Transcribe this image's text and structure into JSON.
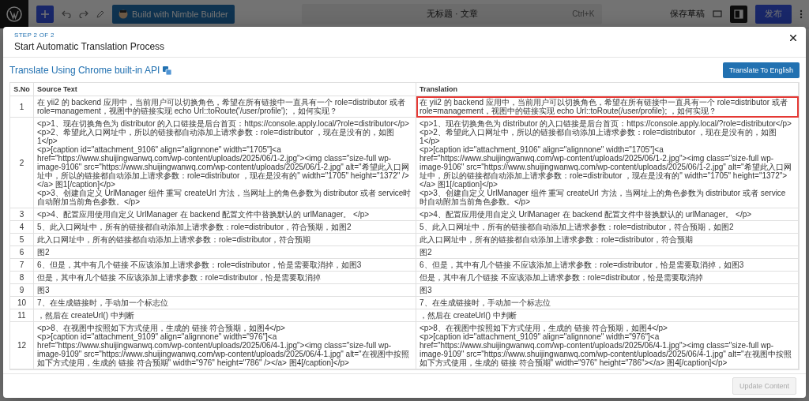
{
  "editor_bar": {
    "builder_button": "Build with Nimble Builder",
    "command_title": "无标题 · 文章",
    "command_shortcut": "Ctrl+K",
    "save_draft": "保存草稿",
    "publish": "发布"
  },
  "modal": {
    "step": "STEP 2 OF 2",
    "title": "Start Automatic Translation Process",
    "heading": "Translate Using Chrome built-in API",
    "translate_button": "Translate To English",
    "update_button": {
      "label": "Update Content",
      "disabled": true
    },
    "table": {
      "columns": [
        "S.No",
        "Source Text",
        "Translation"
      ],
      "rows": [
        {
          "no": "1",
          "source": "在 yii2 的 backend 应用中，当前用户可以切换角色，希望在所有链接中一直具有一个 role=distributor 或者 role=management，视图中的链接实现 echo Url::toRoute('/user/profile'); ，如何实现？",
          "translation": "在 yii2 的 backend 应用中，当前用户可以切换角色，希望在所有链接中一直具有一个 role=distributor 或者 role=management，视图中的链接实现 echo Url::toRoute(/user/profile); ，如何实现？",
          "highlighted": true
        },
        {
          "no": "2",
          "source": "<p>1、现在切换角色为 distributor 的入口链接是后台首页：https://console.apply.local/?role=distributor</p>\n<p>2、希望此入口网址中，所以的链接都自动添加上请求参数：role=distributor ，现在是没有的，如图1</p>\n<p>[caption id=\"attachment_9106\" align=\"alignnone\" width=\"1705\"]<a href=\"https://www.shuijingwanwq.com/wp-content/uploads/2025/06/1-2.jpg\"><img class=\"size-full wp-image-9106\" src=\"https://www.shuijingwanwq.com/wp-content/uploads/2025/06/1-2.jpg\" alt=\"希望此入口网址中，所以的链接都自动添加上请求参数：role=distributor ，现在是没有的\" width=\"1705\" height=\"1372\" /></a> 图1[/caption]</p>\n<p>3、创建自定义 UrlManager 组件 重写 createUrl 方法，当网址上的角色参数为 distributor 或者 service时自动附加当前角色参数。</p>",
          "translation": "<p>1、现在切换角色为 distributor 的入口链接是后台首页：https://console.apply.local/?role=distributor</p>\n<p>2、希望此入口网址中，所以的链接都自动添加上请求参数：role=distributor ，现在是没有的，如图1</p>\n<p>[caption id=\"attachment_9106\" align=\"alignnone\" width=\"1705\"]<a href=\"https://www.shuijingwanwq.com/wp-content/uploads/2025/06/1-2.jpg\"><img class=\"size-full wp-image-9106\" src=\"https://www.shuijingwanwq.com/wp-content/uploads/2025/06/1-2.jpg\" alt=\"希望此入口网址中，所以的链接都自动添加上请求参数：role=distributor ，现在是没有的\" width=\"1705\" height=\"1372\"></a> 图1[/caption]</p>\n<p>3、创建自定义 UrlManager 组件 重写 createUrl 方法，当网址上的角色参数为 distributor 或者 service 时自动附加当前角色参数。</p>",
          "highlighted": false
        },
        {
          "no": "3",
          "source": "<p>4、配置应用使用自定义 UrlManager 在 backend 配置文件中替换默认的 urlManager。 </p>",
          "translation": "<p>4、配置应用使用自定义 UrlManager 在 backend 配置文件中替换默认的 urlManager。 </p>",
          "highlighted": false
        },
        {
          "no": "4",
          "source": "5、此入口网址中，所有的链接都自动添加上请求参数：role=distributor，符合预期，如图2",
          "translation": "5、此入口网址中，所有的链接都自动添加上请求参数：role=distributor，符合预期，如图2",
          "highlighted": false
        },
        {
          "no": "5",
          "source": "此入口网址中，所有的链接都自动添加上请求参数：role=distributor，符合预期",
          "translation": "此入口网址中，所有的链接都自动添加上请求参数：role=distributor，符合预期",
          "highlighted": false
        },
        {
          "no": "6",
          "source": "图2",
          "translation": "图2",
          "highlighted": false
        },
        {
          "no": "7",
          "source": "6、但是，其中有几个链接 不应该添加上请求参数：role=distributor，恰是需要取消掉，如图3",
          "translation": "6、但是，其中有几个链接 不应该添加上请求参数：role=distributor，恰是需要取消掉，如图3",
          "highlighted": false
        },
        {
          "no": "8",
          "source": "但是，其中有几个链接 不应该添加上请求参数：role=distributor，恰是需要取消掉",
          "translation": "但是，其中有几个链接 不应该添加上请求参数：role=distributor，恰是需要取消掉",
          "highlighted": false
        },
        {
          "no": "9",
          "source": "图3",
          "translation": "图3",
          "highlighted": false
        },
        {
          "no": "10",
          "source": "7、在生成链接时，手动加一个标志位",
          "translation": "7、在生成链接时，手动加一个标志位",
          "highlighted": false
        },
        {
          "no": "11",
          "source": "，然后在 createUrl() 中判断",
          "translation": "，然后在 createUrl() 中判断",
          "highlighted": false
        },
        {
          "no": "12",
          "source": "<p>8、在视图中按照如下方式使用，生成的 链接 符合预期，如图4</p>\n<p>[caption id=\"attachment_9109\" align=\"alignnone\" width=\"976\"]<a href=\"https://www.shuijingwanwq.com/wp-content/uploads/2025/06/4-1.jpg\"><img class=\"size-full wp-image-9109\" src=\"https://www.shuijingwanwq.com/wp-content/uploads/2025/06/4-1.jpg\" alt=\"在视图中按照如下方式使用，生成的 链接 符合预期\" width=\"976\" height=\"786\" /></a> 图4[/caption]</p>",
          "translation": "<p>8、在视图中按照如下方式使用，生成的 链接 符合预期，如图4</p>\n<p>[caption id=\"attachment_9109\" align=\"alignnone\" width=\"976\"]<a href=\"https://www.shuijingwanwq.com/wp-content/uploads/2025/06/4-1.jpg\"><img class=\"size-full wp-image-9109\" src=\"https://www.shuijingwanwq.com/wp-content/uploads/2025/06/4-1.jpg\" alt=\"在视图中按照如下方式使用，生成的 链接 符合预期\" width=\"976\" height=\"786\"></a> 图4[/caption]</p>",
          "highlighted": false
        }
      ]
    }
  }
}
